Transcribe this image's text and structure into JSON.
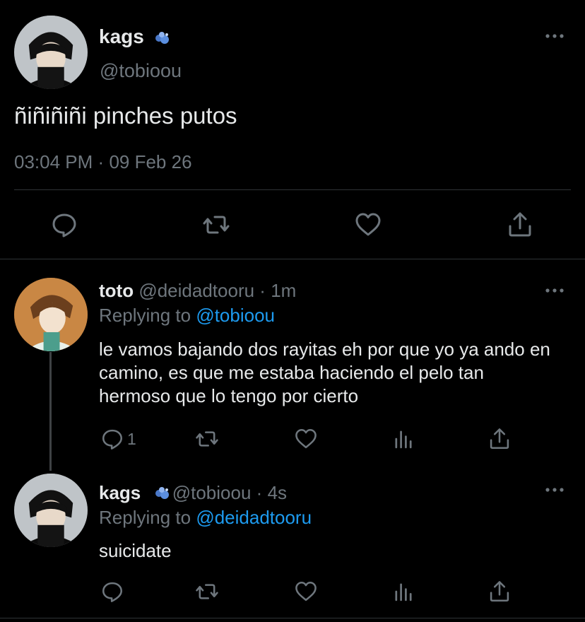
{
  "main_tweet": {
    "name": "kags",
    "handle": "@tobioou",
    "text": "ñiñiñiñi pinches putos",
    "time": "03:04 PM",
    "date_sep": "·",
    "date": "09 Feb 26"
  },
  "replies": [
    {
      "name": "toto",
      "handle": "@deidadtooru",
      "sep": "·",
      "age": "1m",
      "replying_label": "Replying to",
      "replying_to": "@tobioou",
      "text": "le vamos bajando dos rayitas eh por que yo ya ando en camino, es que me estaba haciendo el pelo tan hermoso que lo tengo por cierto",
      "reply_count": "1"
    },
    {
      "name": "kags",
      "handle": "@tobioou",
      "sep": "·",
      "age": "4s",
      "replying_label": "Replying to",
      "replying_to": "@deidadtooru",
      "text": "suicidate"
    }
  ],
  "icons": {
    "verified": "verified-badge-icon",
    "more": "more-options-icon",
    "reply": "reply-icon",
    "retweet": "retweet-icon",
    "like": "like-icon",
    "analytics": "analytics-icon",
    "share": "share-icon"
  },
  "colors": {
    "background": "#000000",
    "text": "#e7e9ea",
    "muted": "#6e767d",
    "link": "#1d9bf0",
    "divider": "#2f3336"
  }
}
